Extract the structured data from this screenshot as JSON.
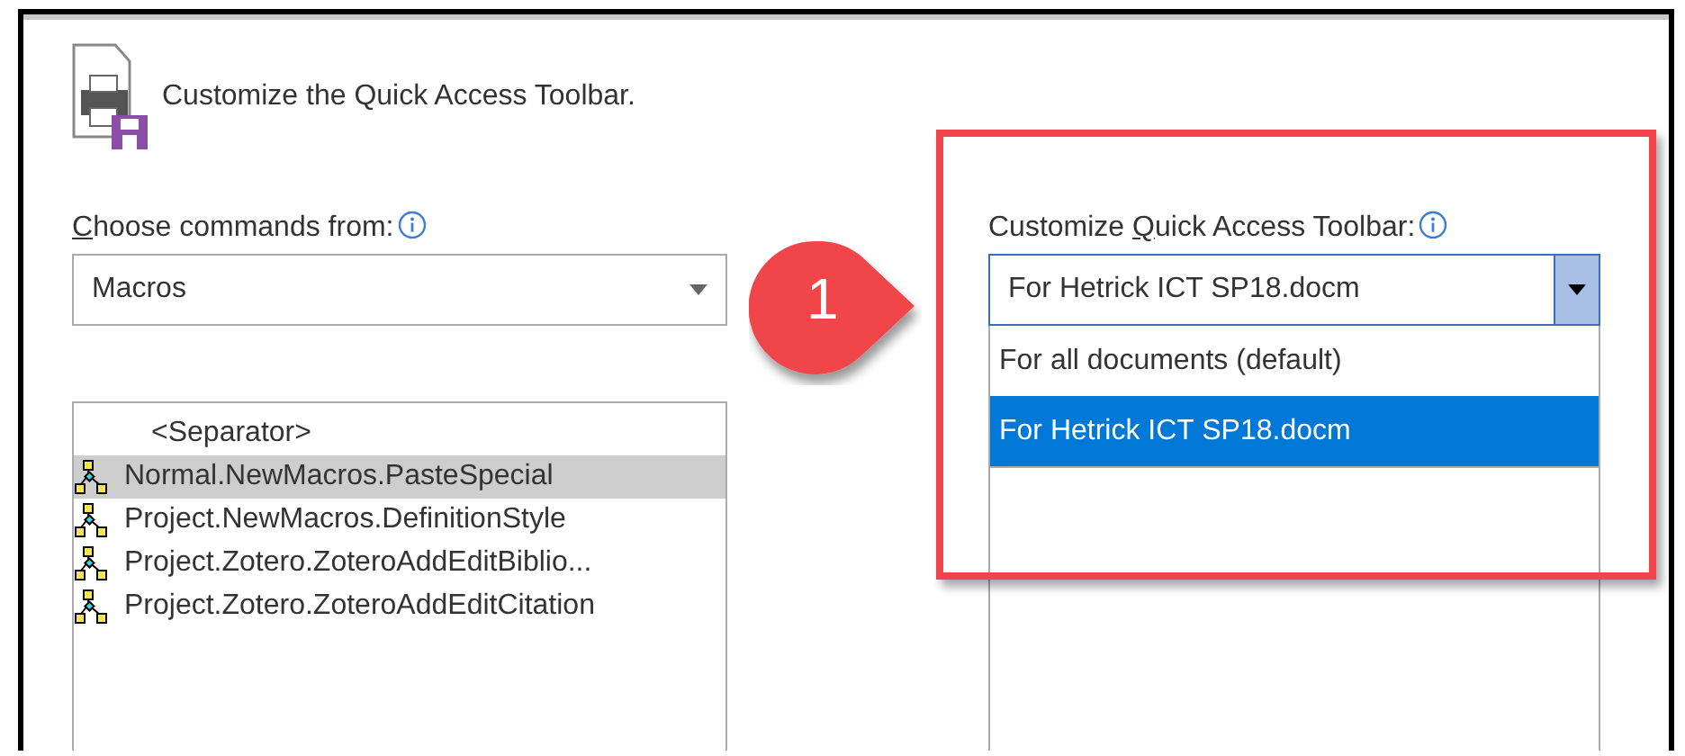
{
  "header": {
    "title": "Customize the Quick Access Toolbar."
  },
  "commands": {
    "label": {
      "key": "C",
      "after": "hoose commands from:"
    },
    "dropdown": {
      "value": "Macros"
    },
    "list": [
      {
        "kind": "separator",
        "text": "<Separator>",
        "selected": false
      },
      {
        "kind": "macro",
        "text": "Normal.NewMacros.PasteSpecial",
        "selected": true
      },
      {
        "kind": "macro",
        "text": "Project.NewMacros.DefinitionStyle",
        "selected": false
      },
      {
        "kind": "macro",
        "text": "Project.Zotero.ZoteroAddEditBiblio...",
        "selected": false
      },
      {
        "kind": "macro",
        "text": "Project.Zotero.ZoteroAddEditCitation",
        "selected": false
      }
    ]
  },
  "callout": {
    "text": "1"
  },
  "toolbar": {
    "label": {
      "before": "Customize ",
      "key": "Q",
      "after": "uick Access Toolbar:"
    },
    "dropdown": {
      "value": "For Hetrick ICT SP18.docm",
      "expanded": true
    },
    "options": [
      {
        "text": "For all documents (default)",
        "selected": false
      },
      {
        "text": "For Hetrick ICT SP18.docm",
        "selected": true
      }
    ]
  }
}
